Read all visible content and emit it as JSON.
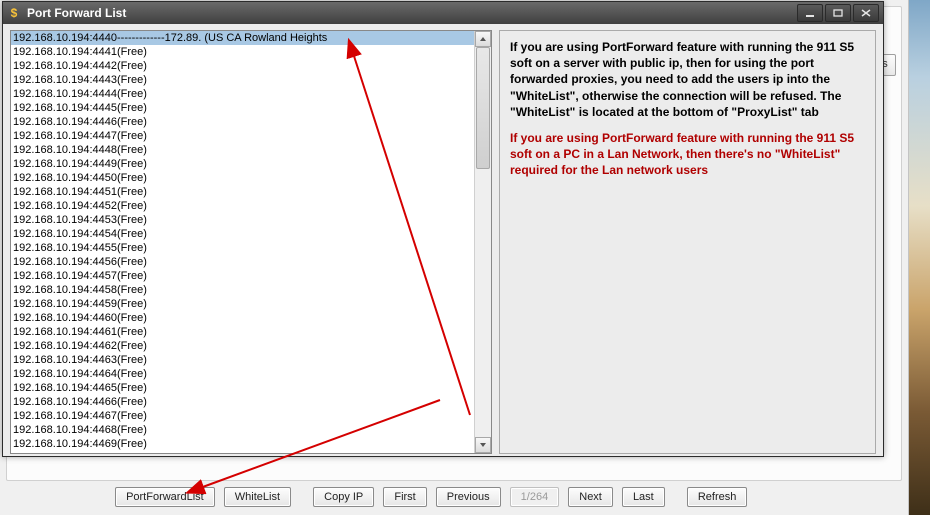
{
  "window": {
    "title": "Port Forward List",
    "icon_glyph": "$"
  },
  "list": {
    "ip": "192.168.10.194",
    "port_start": 4440,
    "port_end": 4469,
    "free_suffix": "(Free)",
    "selected_port": 4440,
    "selected_tail": "-------------172.89.           (US CA Rowland Heights"
  },
  "info": {
    "para1": "If you are using PortForward feature with running the 911 S5 soft on a server with public ip, then for using the port forwarded proxies, you need to add the users ip into the \"WhiteList\", otherwise the connection will be refused. The \"WhiteList\" is located at the bottom of \"ProxyList\" tab",
    "para2": "If you are using PortForward feature with running the 911 S5 soft on a PC in a Lan Network, then there's no \"WhiteList\" required for the Lan network users"
  },
  "toolbar": {
    "port_forward_list": "PortForwardList",
    "white_list": "WhiteList",
    "copy_ip": "Copy IP",
    "first": "First",
    "previous": "Previous",
    "page_indicator": "1/264",
    "next": "Next",
    "last": "Last",
    "refresh": "Refresh"
  },
  "bg": {
    "peek_button": "gs"
  }
}
